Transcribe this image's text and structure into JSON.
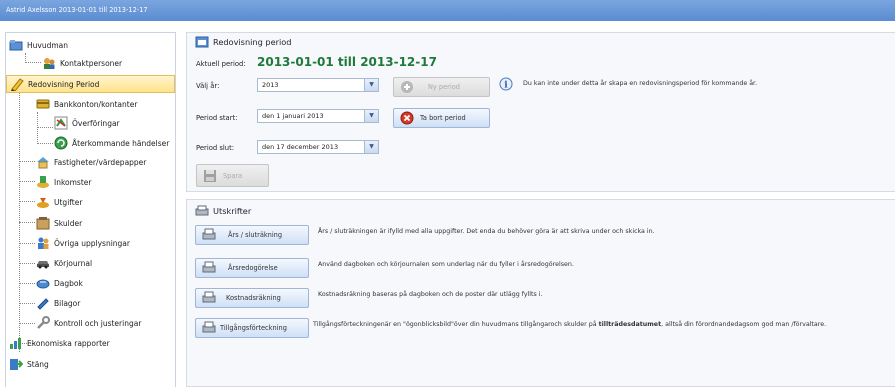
{
  "window": {
    "title": "Astrid Axelsson 2013-01-01 till 2013-12-17"
  },
  "sidebar": {
    "items": [
      {
        "label": "Huvudman",
        "icon": "folder-icon"
      },
      {
        "label": "Kontaktpersoner",
        "icon": "contacts-icon"
      },
      {
        "label": "Redovisning Period",
        "icon": "pencil-icon",
        "selected": true
      },
      {
        "label": "Bankkonton/kontanter",
        "icon": "bank-icon"
      },
      {
        "label": "Överföringar",
        "icon": "transfer-icon"
      },
      {
        "label": "Återkommande händelser",
        "icon": "recurring-icon"
      },
      {
        "label": "Fastigheter/värdepapper",
        "icon": "property-icon"
      },
      {
        "label": "Inkomster",
        "icon": "income-icon"
      },
      {
        "label": "Utgifter",
        "icon": "expense-icon"
      },
      {
        "label": "Skulder",
        "icon": "debt-icon"
      },
      {
        "label": "Övriga upplysningar",
        "icon": "info-people-icon"
      },
      {
        "label": "Körjournal",
        "icon": "car-icon"
      },
      {
        "label": "Dagbok",
        "icon": "diary-icon"
      },
      {
        "label": "Bilagor",
        "icon": "attachment-icon"
      },
      {
        "label": "Kontroll och justeringar",
        "icon": "wrench-icon"
      },
      {
        "label": "Ekonomiska rapporter",
        "icon": "chart-icon"
      },
      {
        "label": "Stäng",
        "icon": "exit-icon"
      }
    ]
  },
  "period": {
    "header": "Redovisning period",
    "current_label": "Aktuell period:",
    "current_value": "2013-01-01 till 2013-12-17",
    "year_label": "Välj år:",
    "year_value": "2013",
    "new_period_button": "Ny period",
    "info_text": "Du kan inte under detta år skapa en redovisningsperiod för kommande år.",
    "start_label": "Period start:",
    "start_value": "den 1 januari 2013",
    "remove_button": "Ta bort period",
    "end_label": "Period slut:",
    "end_value": "den 17 december 2013",
    "save_button": "Spara"
  },
  "reports": {
    "header": "Utskrifter",
    "items": [
      {
        "button": "Års / sluträkning",
        "text": "Års / sluträkningen är ifylld med alla uppgifter. Det enda du behöver göra är att skriva under och skicka in."
      },
      {
        "button": "Årsredogörelse",
        "text": "Använd dagboken och körjournalen som underlag när du fyller i årsredogörelsen."
      },
      {
        "button": "Kostnadsräkning",
        "text": "Kostnadsräkning baseras på dagboken och de poster där utlägg fyllts i."
      },
      {
        "button": "Tillgångsförteckning",
        "text_pre": "Tillgångsförteckningenär en \"ögonblicksbild\"över din huvudmans tillgångaroch skulder på ",
        "text_bold": "tillträdesdatumet",
        "text_post": ", alltså din förordnandedagsom god man /förvaltare."
      }
    ]
  },
  "colors": {
    "accent": "#1f7a3a",
    "titlebar": "#6b9ad8",
    "selected": "#ffe38a"
  }
}
